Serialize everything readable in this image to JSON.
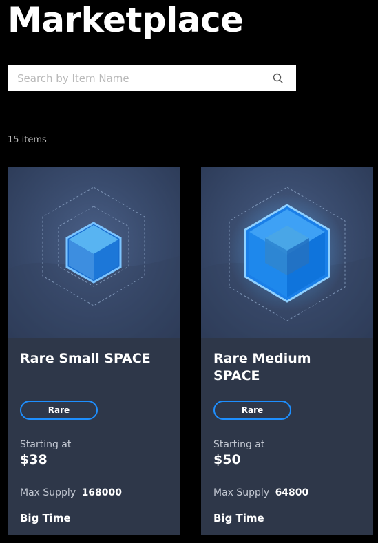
{
  "page": {
    "title": "Marketplace"
  },
  "search": {
    "placeholder": "Search by Item Name",
    "value": "",
    "icon": "search-icon"
  },
  "results": {
    "count_label": "15 items"
  },
  "labels": {
    "starting_at": "Starting at",
    "max_supply": "Max Supply"
  },
  "colors": {
    "background": "#000000",
    "card": "#2e3749",
    "badge_border": "#1e8fff",
    "cube": "#2196f3"
  },
  "items": [
    {
      "name": "Rare Small SPACE",
      "rarity": "Rare",
      "price": "$38",
      "max_supply": "168000",
      "publisher": "Big Time",
      "image": "small-space-cube"
    },
    {
      "name": "Rare Medium SPACE",
      "rarity": "Rare",
      "price": "$50",
      "max_supply": "64800",
      "publisher": "Big Time",
      "image": "medium-space-cube"
    }
  ]
}
